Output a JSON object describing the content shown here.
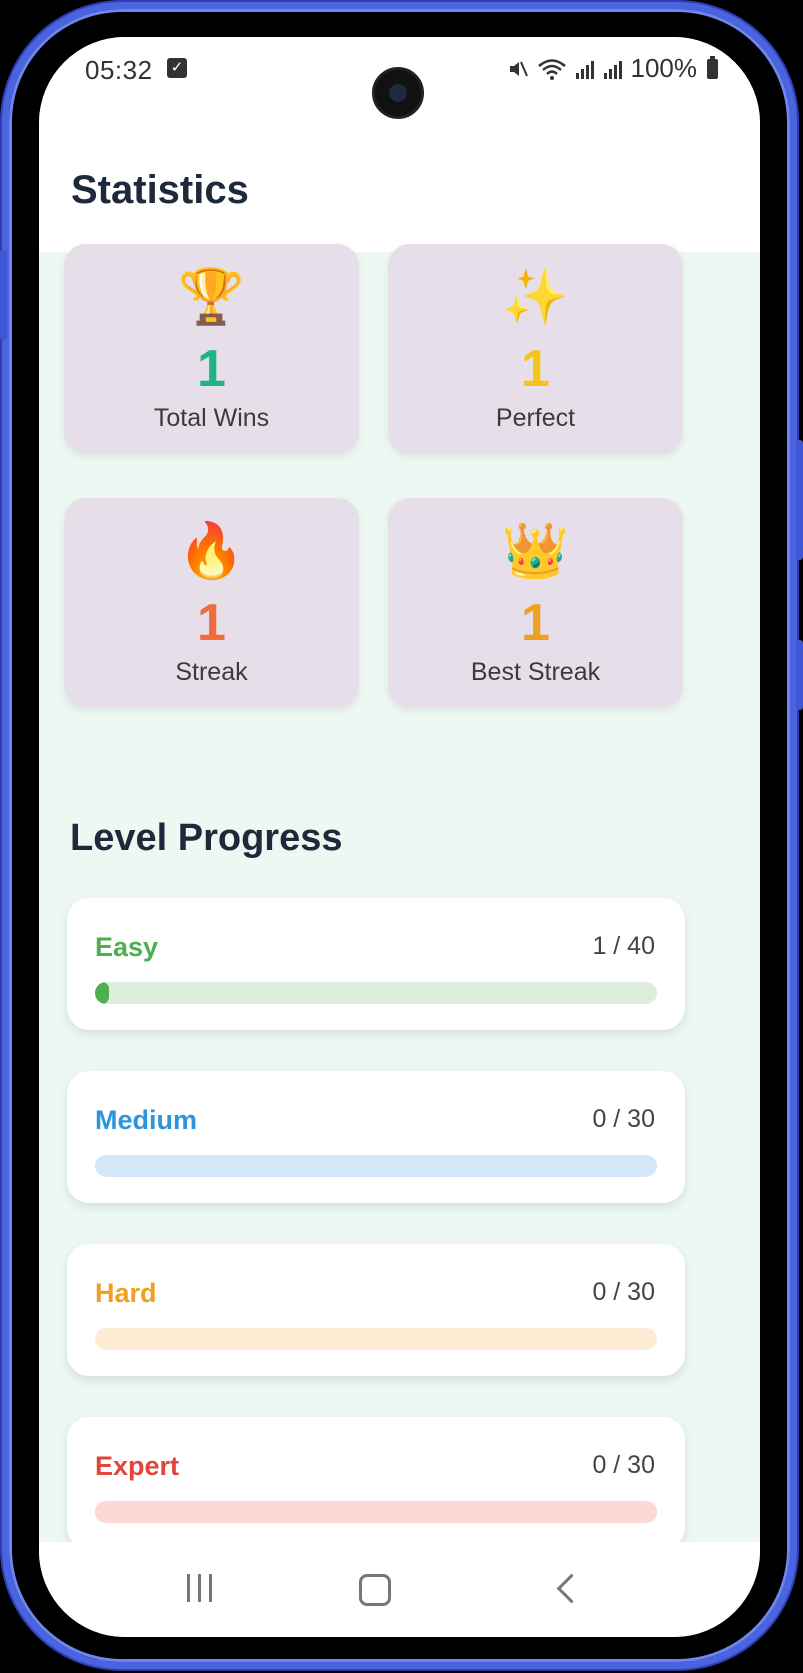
{
  "status_bar": {
    "time": "05:32",
    "battery": "100%",
    "icons": [
      "check-icon",
      "mute-icon",
      "wifi-icon",
      "signal-icon",
      "signal-icon",
      "battery-icon"
    ]
  },
  "header": {
    "title": "Statistics"
  },
  "stats": [
    {
      "emoji": "🏆",
      "icon": "trophy-icon",
      "value": "1",
      "label": "Total Wins",
      "color": "#1db488"
    },
    {
      "emoji": "✨",
      "icon": "sparkles-icon",
      "value": "1",
      "label": "Perfect",
      "color": "#f5c518"
    },
    {
      "emoji": "🔥",
      "icon": "fire-icon",
      "value": "1",
      "label": "Streak",
      "color": "#f26b3a"
    },
    {
      "emoji": "👑",
      "icon": "crown-icon",
      "value": "1",
      "label": "Best Streak",
      "color": "#f0a020"
    }
  ],
  "level_progress": {
    "title": "Level Progress",
    "levels": [
      {
        "name": "Easy",
        "count": "1 / 40",
        "progress": 0.025,
        "color": "#4caf50",
        "track": "#ddeedd"
      },
      {
        "name": "Medium",
        "count": "0 / 30",
        "progress": 0,
        "color": "#2b95dd",
        "track": "#d5e8fa"
      },
      {
        "name": "Hard",
        "count": "0 / 30",
        "progress": 0,
        "color": "#f0a020",
        "track": "#fdebd3"
      },
      {
        "name": "Expert",
        "count": "0 / 30",
        "progress": 0,
        "color": "#e0463c",
        "track": "#fbd8d6"
      }
    ]
  },
  "nav": {
    "icons": [
      "recents-icon",
      "home-icon",
      "back-icon"
    ]
  }
}
